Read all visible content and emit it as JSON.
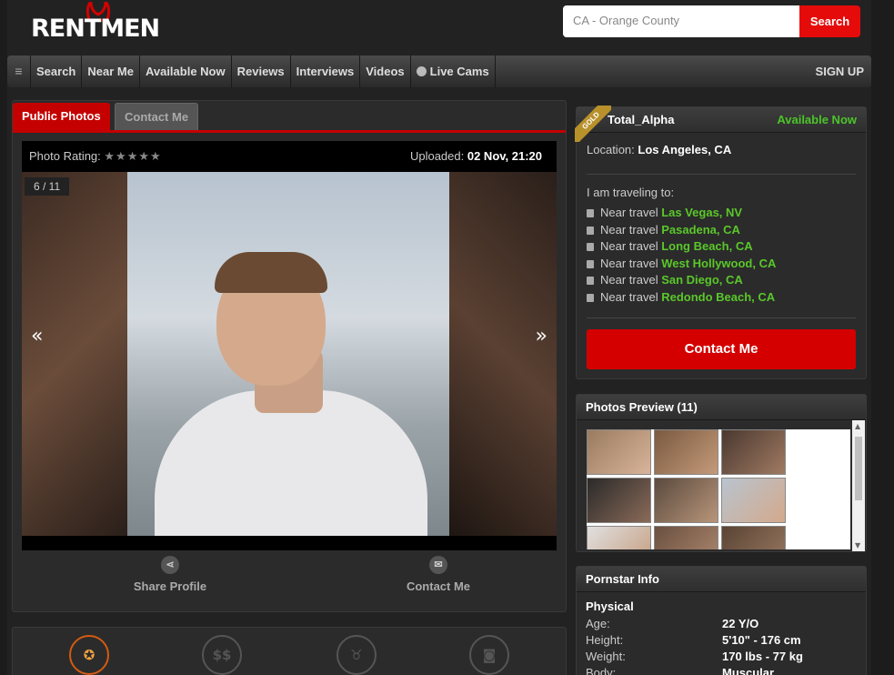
{
  "brand": {
    "logo_text": "RENTMEN"
  },
  "search": {
    "placeholder": "CA - Orange County",
    "button_label": "Search"
  },
  "nav": {
    "items": [
      "Search",
      "Near Me",
      "Available Now",
      "Reviews",
      "Interviews",
      "Videos",
      "Live Cams"
    ],
    "signup_label": "SIGN UP"
  },
  "tabs": {
    "active": "Public Photos",
    "inactive": "Contact Me"
  },
  "photo": {
    "rating_label": "Photo Rating:",
    "stars": "★★★★★",
    "uploaded_label": "Uploaded:",
    "uploaded_date": "02 Nov, 21:20",
    "counter": "6 / 11",
    "prev": "«",
    "next": "»"
  },
  "actions": {
    "share_label": "Share Profile",
    "contact_label": "Contact Me"
  },
  "profile": {
    "badge": "GOLD",
    "username": "Total_Alpha",
    "status": "Available Now",
    "location_label": "Location:",
    "location": "Los Angeles, CA",
    "travel_title": "I am traveling to:",
    "travel_prefix": "Near travel",
    "travel": [
      "Las Vegas, NV",
      "Pasadena, CA",
      "Long Beach, CA",
      "West Hollywood, CA",
      "San Diego, CA",
      "Redondo Beach, CA"
    ],
    "contact_button": "Contact Me"
  },
  "preview": {
    "title": "Photos Preview (11)"
  },
  "info": {
    "title": "Pornstar Info",
    "section": "Physical",
    "rows": [
      {
        "label": "Age:",
        "value": "22 Y/O"
      },
      {
        "label": "Height:",
        "value": "5'10\" - 176 cm"
      },
      {
        "label": "Weight:",
        "value": "170 lbs - 77 kg"
      },
      {
        "label": "Body:",
        "value": "Muscular"
      }
    ]
  },
  "colors": {
    "accent_red": "#d40000",
    "available_green": "#4cc42a",
    "gold": "#b8912b"
  }
}
